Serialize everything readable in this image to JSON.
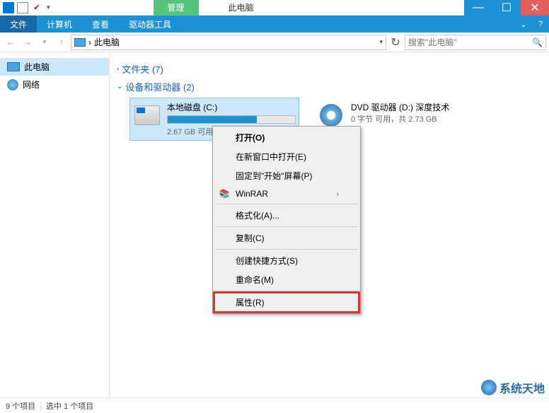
{
  "titlebar": {
    "manage_tab": "管理",
    "thispc_tab": "此电脑"
  },
  "menubar": {
    "file": "文件",
    "computer": "计算机",
    "view": "查看",
    "drive_tools": "驱动器工具"
  },
  "addressbar": {
    "path": "此电脑",
    "search_placeholder": "搜索\"此电脑\""
  },
  "sidebar": {
    "items": [
      {
        "label": "此电脑"
      },
      {
        "label": "网络"
      }
    ]
  },
  "content": {
    "folders_section": "文件夹 (7)",
    "devices_section": "设备和驱动器 (2)",
    "drives": [
      {
        "name": "本地磁盘 (C:)",
        "free_text": "2.67 GB 可用",
        "fill_percent": 70,
        "selected": true
      },
      {
        "name": "DVD 驱动器 (D:) 深度技术",
        "free_text": "0 字节 可用，共 2.73 GB",
        "type": "dvd"
      }
    ]
  },
  "context_menu": {
    "open": "打开(O)",
    "open_new_window": "在新窗口中打开(E)",
    "pin_start": "固定到\"开始\"屏幕(P)",
    "winrar": "WinRAR",
    "format": "格式化(A)...",
    "copy": "复制(C)",
    "create_shortcut": "创建快捷方式(S)",
    "rename": "重命名(M)",
    "properties": "属性(R)"
  },
  "statusbar": {
    "items_count": "9 个项目",
    "selected_count": "选中 1 个项目"
  },
  "watermark": "系统天地"
}
